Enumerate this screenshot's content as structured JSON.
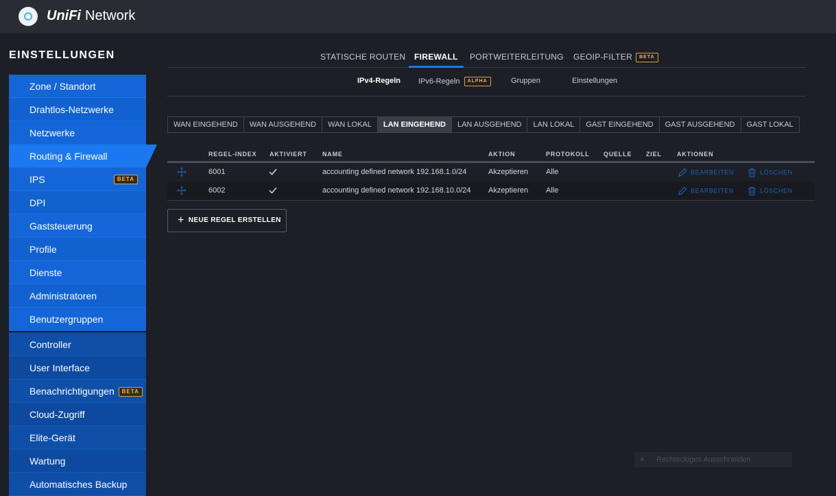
{
  "app": {
    "brand_unifi": "UniFi",
    "brand_network": "Network"
  },
  "settings_title": "EINSTELLUNGEN",
  "sidebar": {
    "group1": [
      {
        "label": "Zone / Standort"
      },
      {
        "label": "Drahtlos-Netzwerke"
      },
      {
        "label": "Netzwerke"
      },
      {
        "label": "Routing & Firewall",
        "active": true
      },
      {
        "label": "IPS",
        "badge": "BETA"
      },
      {
        "label": "DPI"
      },
      {
        "label": "Gaststeuerung"
      },
      {
        "label": "Profile"
      },
      {
        "label": "Dienste"
      },
      {
        "label": "Administratoren"
      },
      {
        "label": "Benutzergruppen"
      }
    ],
    "group2": [
      {
        "label": "Controller"
      },
      {
        "label": "User Interface"
      },
      {
        "label": "Benachrichtigungen",
        "badge": "BETA"
      },
      {
        "label": "Cloud-Zugriff"
      },
      {
        "label": "Elite-Gerät"
      },
      {
        "label": "Wartung"
      },
      {
        "label": "Automatisches Backup"
      }
    ]
  },
  "top_tabs": [
    {
      "label": "STATISCHE ROUTEN"
    },
    {
      "label": "FIREWALL",
      "active": true
    },
    {
      "label": "PORTWEITERLEITUNG"
    },
    {
      "label": "GEOIP-FILTER",
      "badge": "BETA"
    }
  ],
  "sub_tabs": [
    {
      "label": "IPv4-Regeln",
      "active": true
    },
    {
      "label": "IPv6-Regeln",
      "badge": "ALPHA"
    },
    {
      "label": "Gruppen"
    },
    {
      "label": "Einstellungen"
    }
  ],
  "rule_sets": [
    {
      "label": "WAN EINGEHEND"
    },
    {
      "label": "WAN AUSGEHEND"
    },
    {
      "label": "WAN LOKAL"
    },
    {
      "label": "LAN EINGEHEND",
      "active": true
    },
    {
      "label": "LAN AUSGEHEND"
    },
    {
      "label": "LAN LOKAL"
    },
    {
      "label": "GAST EINGEHEND"
    },
    {
      "label": "GAST AUSGEHEND"
    },
    {
      "label": "GAST LOKAL"
    }
  ],
  "table": {
    "headers": {
      "index": "REGEL-INDEX",
      "enabled": "AKTIVIERT",
      "name": "NAME",
      "action": "AKTION",
      "protocol": "PROTOKOLL",
      "source": "QUELLE",
      "dest": "ZIEL",
      "actions": "AKTIONEN"
    },
    "rows": [
      {
        "index": "6001",
        "enabled": true,
        "name": "accounting defined network 192.168.1.0/24",
        "action": "Akzeptieren",
        "protocol": "Alle",
        "source": "",
        "dest": ""
      },
      {
        "index": "6002",
        "enabled": true,
        "name": "accounting defined network 192.168.10.0/24",
        "action": "Akzeptieren",
        "protocol": "Alle",
        "source": "",
        "dest": ""
      }
    ],
    "edit_label": "BEARBEITEN",
    "delete_label": "LÖSCHEN"
  },
  "new_rule_label": "NEUE REGEL ERSTELLEN",
  "overlay_label": "Rechteckiges Ausschneiden"
}
